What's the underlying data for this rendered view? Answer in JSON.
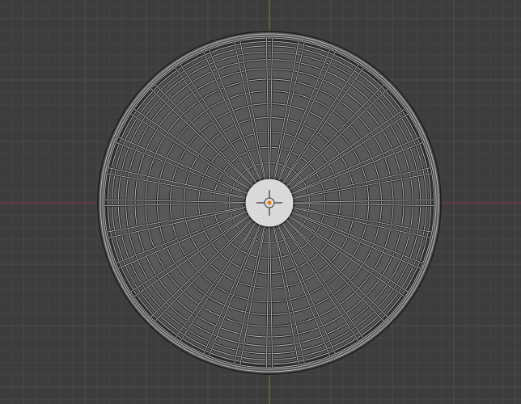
{
  "viewport": {
    "label": "",
    "background_color": "#3d3d3d",
    "grid_minor_color": "#464646",
    "grid_major_color": "#4d4d4d",
    "axis_x_color": "#8a3b43",
    "axis_y_color": "#6b8a2e",
    "view": "top-orthographic",
    "mesh": {
      "type": "wireframe",
      "shape": "dome",
      "radial_segments": 32,
      "rings": 14,
      "wire_color": "#b8b8b8",
      "wire_dark_color": "#1f1f1f",
      "fill_color": "#585858",
      "center_cap_color": "#d9d9d9"
    },
    "origin_marker": {
      "name": "object-origin",
      "crosshair_color": "#333333",
      "dot_color": "#e07a1f"
    },
    "grid_visible": true
  }
}
